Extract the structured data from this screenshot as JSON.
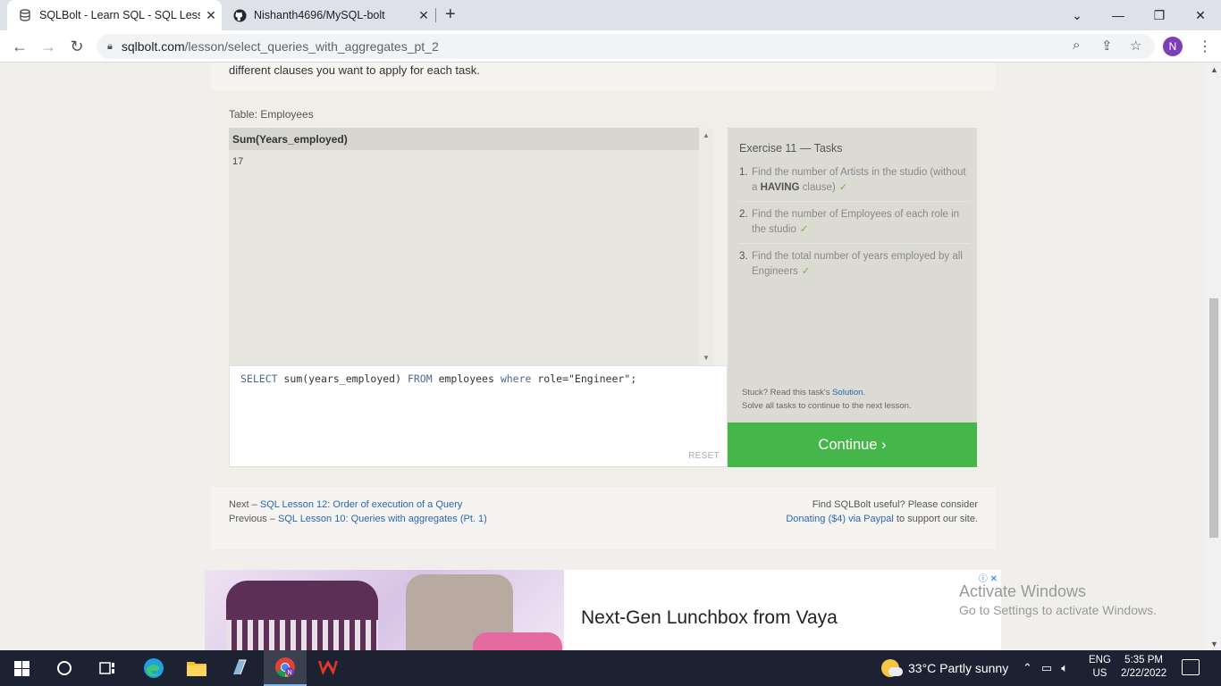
{
  "browser": {
    "tabs": [
      {
        "title": "SQLBolt - Learn SQL - SQL Lesso",
        "active": true
      },
      {
        "title": "Nishanth4696/MySQL-bolt",
        "active": false
      }
    ],
    "url_domain": "sqlbolt.com",
    "url_path": "/lesson/select_queries_with_aggregates_pt_2",
    "profile_initial": "N"
  },
  "page": {
    "intro_text": "different clauses you want to apply for each task.",
    "table_label": "Table: Employees",
    "result": {
      "column": "Sum(Years_employed)",
      "rows": [
        "17"
      ]
    },
    "query": {
      "kw_select": "SELECT",
      "expr": " sum(years_employed) ",
      "kw_from": "FROM",
      "table": " employees ",
      "kw_where": "where",
      "cond": " role=\"Engineer\";"
    },
    "reset_label": "RESET",
    "tasks": {
      "title": "Exercise 11 — Tasks",
      "items": [
        {
          "num": "1.",
          "text": "Find the number of Artists in the studio (without a ",
          "bold": "HAVING",
          "after": " clause)",
          "check": "✓"
        },
        {
          "num": "2.",
          "text": "Find the number of Employees of each role in the studio",
          "bold": "",
          "after": "",
          "check": "✓"
        },
        {
          "num": "3.",
          "text": "Find the total number of years employed by all Engineers",
          "bold": "",
          "after": "",
          "check": "✓"
        }
      ],
      "stuck_prefix": "Stuck? Read this task's ",
      "stuck_link": "Solution",
      "stuck_suffix": ".",
      "solve_all": "Solve all tasks to continue to the next lesson."
    },
    "continue_label": "Continue ›",
    "footer": {
      "next_prefix": "Next – ",
      "next_link": "SQL Lesson 12: Order of execution of a Query",
      "prev_prefix": "Previous – ",
      "prev_link": "SQL Lesson 10: Queries with aggregates (Pt. 1)",
      "support_line1": "Find SQLBolt useful? Please consider",
      "support_link": "Donating ($4) via Paypal",
      "support_suffix": " to support our site."
    },
    "ad": {
      "headline": "Next-Gen Lunchbox from Vaya",
      "choices": "ⓘ ✕"
    },
    "watermark": {
      "line1": "Activate Windows",
      "line2": "Go to Settings to activate Windows."
    }
  },
  "taskbar": {
    "weather": "33°C  Partly sunny",
    "lang_top": "ENG",
    "lang_bottom": "US",
    "time": "5:35 PM",
    "date": "2/22/2022"
  },
  "colors": {
    "continue_green": "#45b649",
    "link_blue": "#2b67b2",
    "check_green": "#7cb342"
  }
}
